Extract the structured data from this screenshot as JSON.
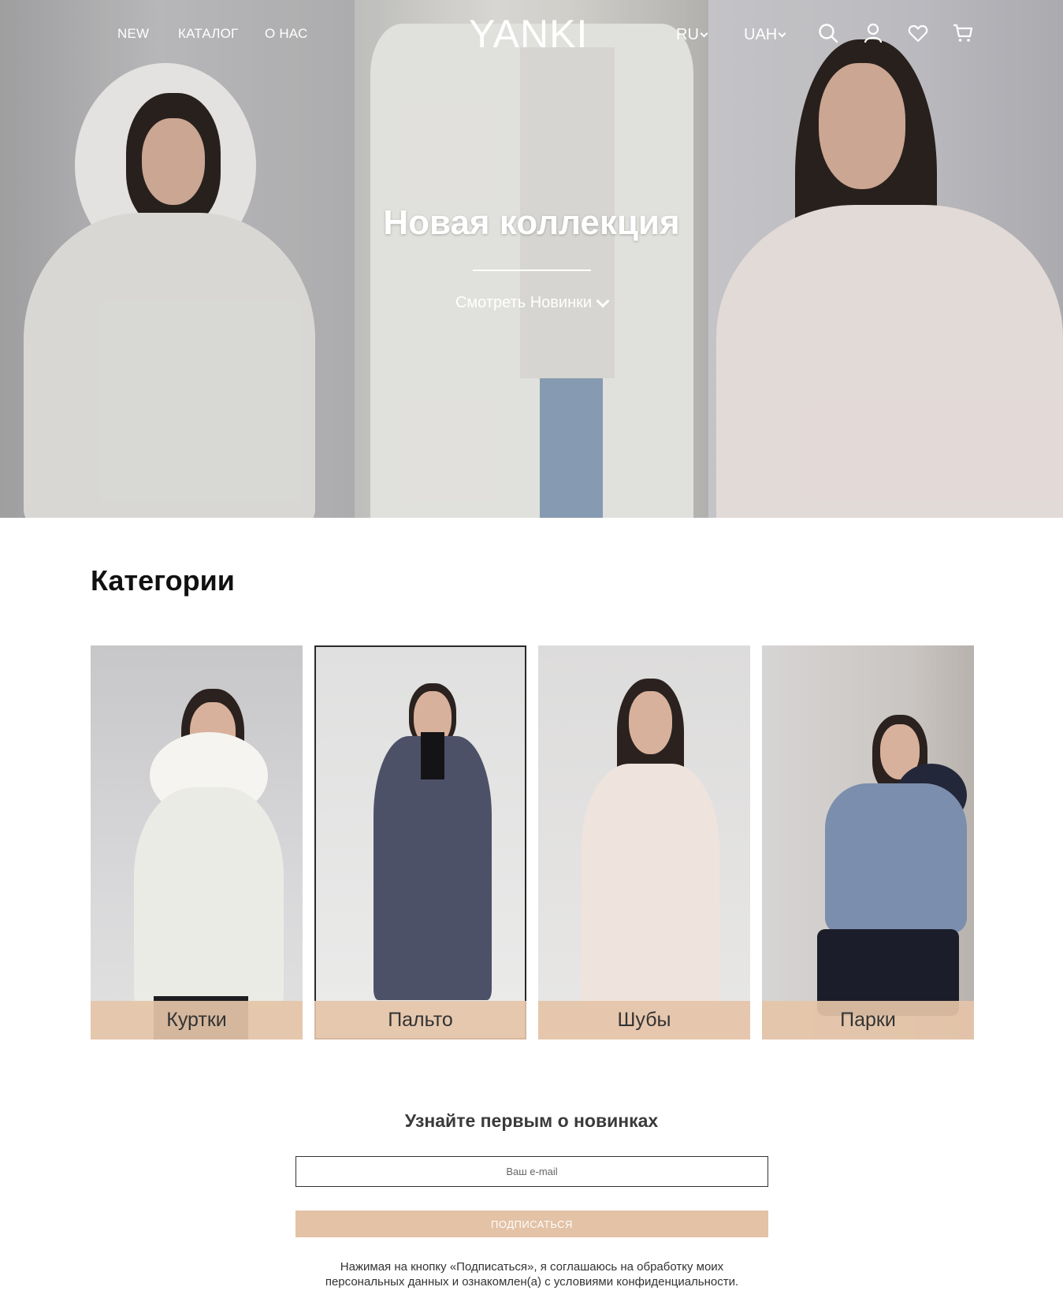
{
  "nav": {
    "links": [
      "NEW",
      "КАТАЛОГ",
      "О НАС"
    ],
    "logo": "YANKI",
    "language": "RU",
    "currency": "UAH"
  },
  "hero": {
    "title": "Новая коллекция",
    "cta": "Смотреть Новинки"
  },
  "categories": {
    "title": "Категории",
    "items": [
      {
        "label": "Куртки",
        "coat_color": "#ebebe6"
      },
      {
        "label": "Пальто",
        "coat_color": "#4d5168"
      },
      {
        "label": "Шубы",
        "coat_color": "#efe4dd"
      },
      {
        "label": "Парки",
        "coat_color": "#7b8ead"
      }
    ]
  },
  "subscribe": {
    "title": "Узнайте первым о новинках",
    "placeholder": "Ваш e-mail",
    "button": "ПОДПИСАТЬСЯ",
    "consent_line1": "Нажимая на кнопку «Подписаться», я соглашаюсь на обработку моих",
    "consent_line2": "персональных данных и ознакомлен(а) с условиями конфиденциальности."
  },
  "colors": {
    "accent": "#e3c2a6",
    "label_bg": "#e5c4a8"
  },
  "icons": [
    "search-icon",
    "user-icon",
    "heart-icon",
    "cart-icon",
    "chevron-down-icon"
  ]
}
